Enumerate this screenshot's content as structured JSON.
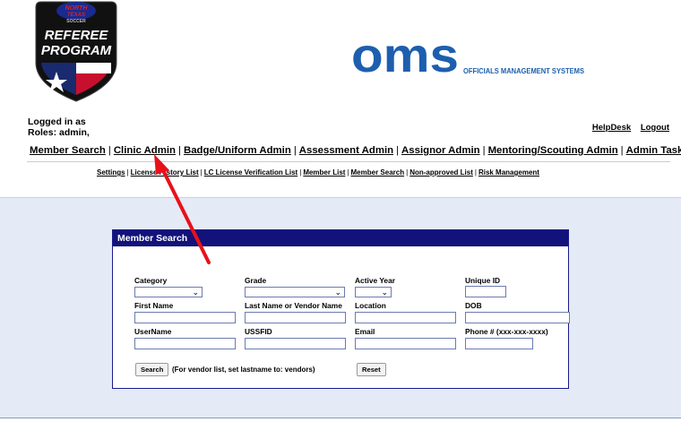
{
  "logos": {
    "referee": {
      "line1": "NORTH",
      "line2": "TEXAS",
      "line3": "SOCCER",
      "line4": "REFEREE",
      "line5": "PROGRAM"
    },
    "oms": {
      "mark": "oms",
      "tagline": "OFFICIALS MANAGEMENT SYSTEMS"
    }
  },
  "login": {
    "logged_in": "Logged in as",
    "roles": "Roles: admin,"
  },
  "toplinks": {
    "helpdesk": "HelpDesk",
    "logout": "Logout"
  },
  "mainnav": [
    "Member Search",
    "Clinic Admin",
    "Badge/Uniform Admin",
    "Assessment Admin",
    "Assignor Admin",
    "Mentoring/Scouting Admin",
    "Admin Tasks"
  ],
  "subnav": [
    "Settings",
    "License History List",
    "LC License Verification List",
    "Member List",
    "Member Search",
    "Non-approved List",
    "Risk Management"
  ],
  "panel": {
    "title": "Member Search",
    "labels": {
      "category": "Category",
      "grade": "Grade",
      "active_year": "Active Year",
      "unique_id": "Unique ID",
      "first_name": "First Name",
      "last_name": "Last Name or Vendor Name",
      "location": "Location",
      "dob": "DOB",
      "username": "UserName",
      "ussfid": "USSFID",
      "email": "Email",
      "phone": "Phone # (xxx-xxx-xxxx)"
    },
    "search_button": "Search",
    "note": "(For vendor list, set lastname to: vendors)",
    "reset_button": "Reset"
  },
  "colors": {
    "panel_header": "#12127a",
    "content_bg": "#e4ebf7",
    "arrow": "#e8111a"
  }
}
